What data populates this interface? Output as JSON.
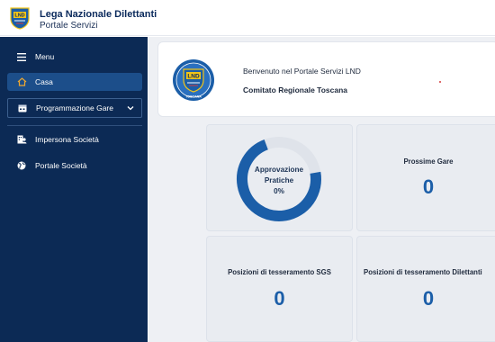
{
  "header": {
    "title": "Lega Nazionale Dilettanti",
    "subtitle": "Portale Servizi",
    "logo_text": "LND"
  },
  "sidebar": {
    "items": [
      {
        "label": "Menu",
        "icon": "hamburger-icon"
      },
      {
        "label": "Casa",
        "icon": "home-icon",
        "active": true
      },
      {
        "label": "Programmazione Gare",
        "icon": "calendar-icon",
        "expandable": true
      },
      {
        "label": "Impersona Società",
        "icon": "user-switch-icon"
      },
      {
        "label": "Portale Società",
        "icon": "globe-icon"
      }
    ]
  },
  "welcome": {
    "line1": "Benvenuto nel Portale Servizi LND",
    "line2": "Comitato Regionale Toscana",
    "logo_text": "LND",
    "logo_sub": "TOSCANA"
  },
  "cards": {
    "approvazione": {
      "title_line1": "Approvazione",
      "title_line2": "Pratiche",
      "value": "0%",
      "progress": 0
    },
    "prossime": {
      "title": "Prossime Gare",
      "value": "0"
    },
    "sgs": {
      "title": "Posizioni di tesseramento SGS",
      "value": "0"
    },
    "dilettanti": {
      "title": "Posizioni di tesseramento Dilettanti",
      "value": "0"
    }
  },
  "colors": {
    "sidebar_bg": "#0c2a55",
    "active_item": "#1c4e8a",
    "accent": "#1b5ea8",
    "donut_track": "#dfe3ea"
  }
}
